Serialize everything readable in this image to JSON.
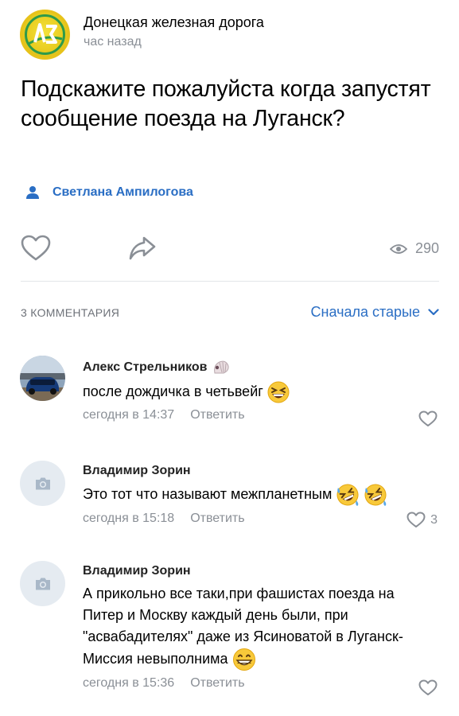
{
  "post": {
    "group_name": "Донецкая железная дорога",
    "time": "час назад",
    "text": "Подскажите пожалуйста когда запустят сообщение поезда на Луганск?",
    "author": "Светлана Ампилогова",
    "views": "290",
    "logo_letters": "ДЖ"
  },
  "comments_section": {
    "count_label": "3 КОММЕНТАРИЯ",
    "sort_label": "Сначала старые"
  },
  "comments": [
    {
      "name": "Алекс Стрельников",
      "text": "после дождичка в четьвейг",
      "time": "сегодня в 14:37",
      "reply": "Ответить",
      "likes": ""
    },
    {
      "name": "Владимир Зорин",
      "text": "Это тот что называют межпланетным",
      "time": "сегодня в 15:18",
      "reply": "Ответить",
      "likes": "3"
    },
    {
      "name": "Владимир Зорин",
      "text": "А прикольно все таки,при фашистах поезда на Питер и Москву каждый день были, при \"асвабадителях\" даже из Ясиноватой в Луганск- Миссия невыполнима",
      "time": "сегодня в 15:36",
      "reply": "Ответить",
      "likes": ""
    }
  ],
  "colors": {
    "accent": "#2a6ec4",
    "secondary_text": "#8a8f96",
    "logo_yellow": "#e9cc1f",
    "logo_green": "#2e9a4a"
  }
}
